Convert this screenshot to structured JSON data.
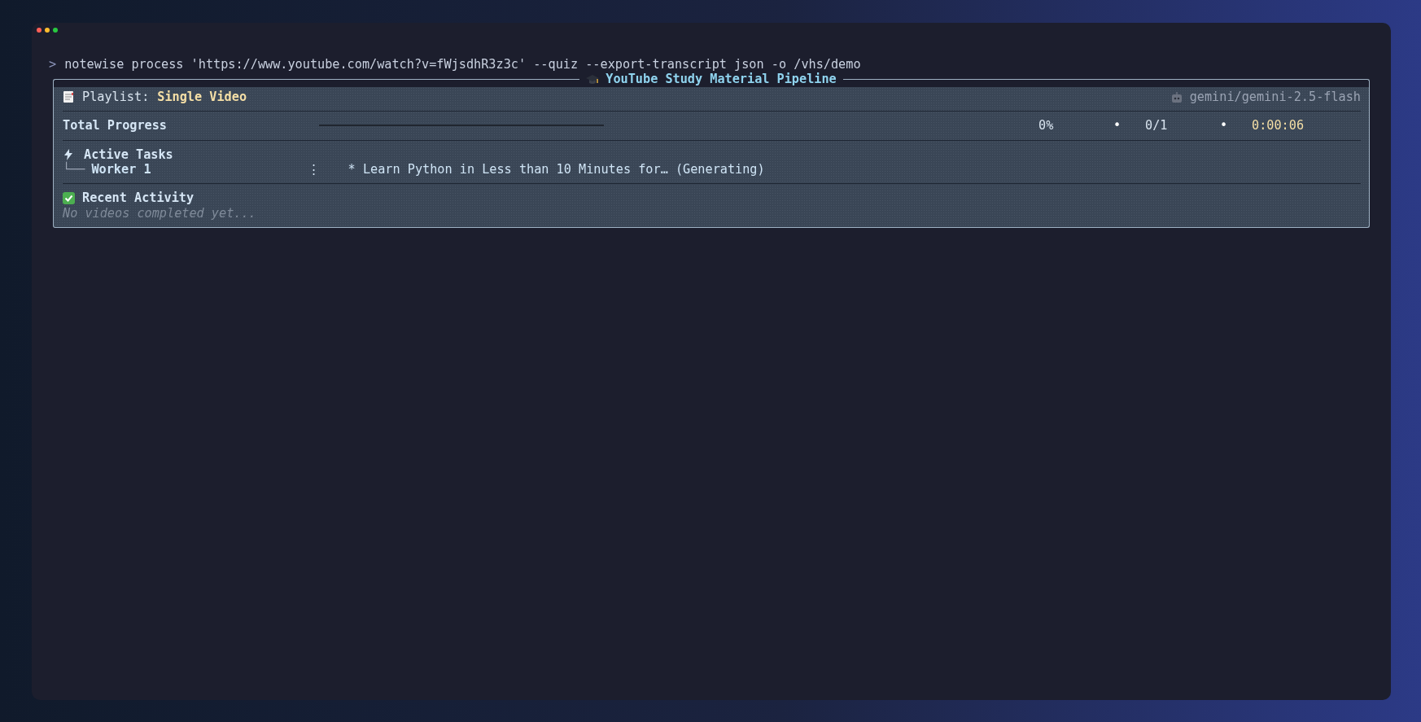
{
  "command": {
    "prompt": ">",
    "text": "notewise process 'https://www.youtube.com/watch?v=fWjsdhR3z3c' --quiz --export-transcript json -o /vhs/demo"
  },
  "panel": {
    "title": "YouTube Study Material Pipeline",
    "playlist_label": "Playlist:",
    "playlist_name": "Single Video",
    "model": "gemini/gemini-2.5-flash",
    "progress": {
      "label": "Total Progress",
      "level": 0,
      "stats": [
        {
          "kind": "value",
          "text": "0%"
        },
        {
          "kind": "separator",
          "text": "•"
        },
        {
          "kind": "value",
          "text": "0/1"
        },
        {
          "kind": "separator",
          "text": "•"
        },
        {
          "kind": "time",
          "text": "0:00:06"
        }
      ]
    },
    "active_tasks": {
      "title": "Active Tasks",
      "workers": [
        {
          "branch": "└──",
          "name": "Worker 1",
          "spinner": "⋮",
          "task": "* Learn Python in Less than 10 Minutes for… (Generating)"
        }
      ]
    },
    "recent_activity": {
      "title": "Recent Activity",
      "empty_text": "No videos completed yet..."
    }
  }
}
